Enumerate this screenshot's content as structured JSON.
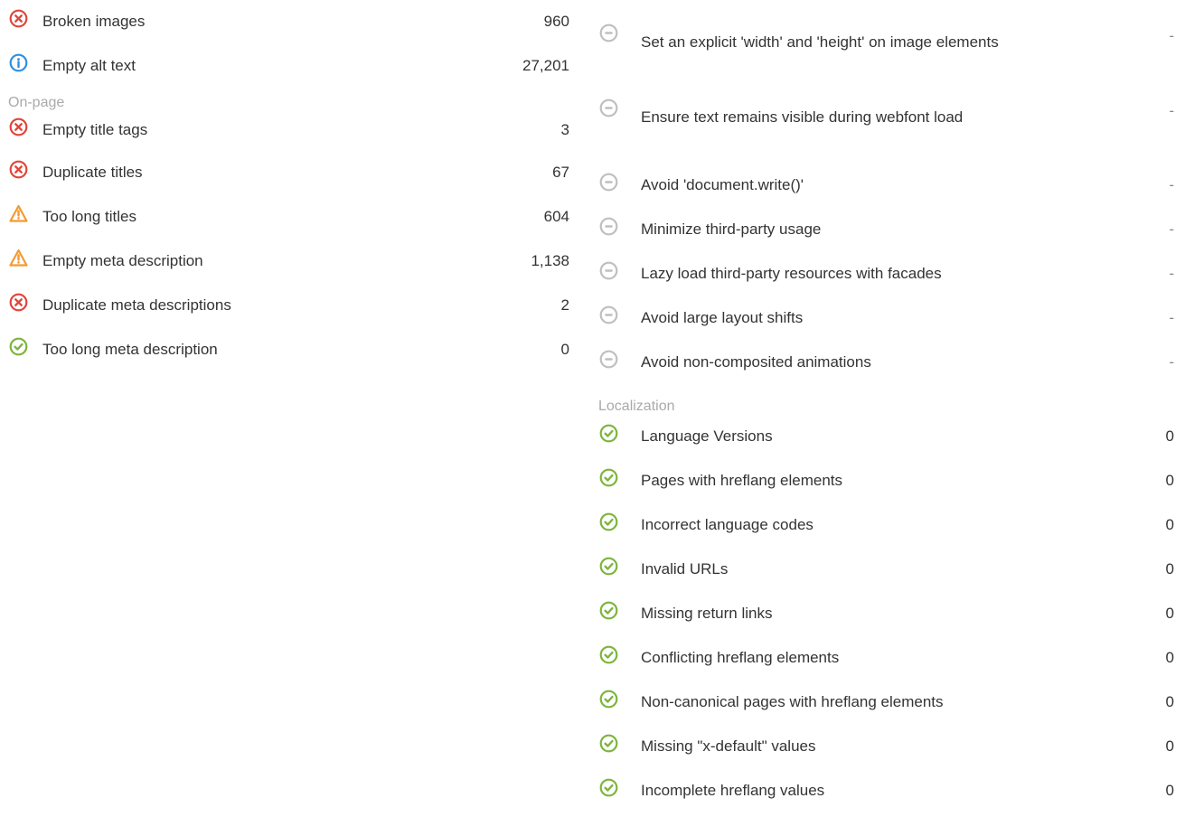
{
  "colors": {
    "error": "#e0453a",
    "info": "#2f8fe0",
    "warning": "#f39a32",
    "ok": "#7cb53b",
    "neutral": "#bfbfbf"
  },
  "left": {
    "top_rows": [
      {
        "icon": "error-circle-icon",
        "label": "Broken images",
        "value": "960"
      },
      {
        "icon": "info-circle-icon",
        "label": "Empty alt text",
        "value": "27,201"
      }
    ],
    "onpage": {
      "title": "On-page",
      "rows": [
        {
          "icon": "error-circle-icon",
          "label": "Empty title tags",
          "value": "3"
        },
        {
          "icon": "error-circle-icon",
          "label": "Duplicate titles",
          "value": "67"
        },
        {
          "icon": "warning-triangle-icon",
          "label": "Too long titles",
          "value": "604"
        },
        {
          "icon": "warning-triangle-icon",
          "label": "Empty meta description",
          "value": "1,138"
        },
        {
          "icon": "error-circle-icon",
          "label": "Duplicate meta descriptions",
          "value": "2"
        },
        {
          "icon": "check-circle-icon",
          "label": "Too long meta description",
          "value": "0"
        }
      ]
    }
  },
  "right": {
    "perf_rows": [
      {
        "icon": "minus-circle-icon",
        "label": "Set an explicit 'width' and 'height' on image elements",
        "value": "-"
      },
      {
        "icon": "minus-circle-icon",
        "label": "Ensure text remains visible during webfont load",
        "value": "-"
      },
      {
        "icon": "minus-circle-icon",
        "label": "Avoid 'document.write()'",
        "value": "-"
      },
      {
        "icon": "minus-circle-icon",
        "label": "Minimize third-party usage",
        "value": "-"
      },
      {
        "icon": "minus-circle-icon",
        "label": "Lazy load third-party resources with facades",
        "value": "-"
      },
      {
        "icon": "minus-circle-icon",
        "label": "Avoid large layout shifts",
        "value": "-"
      },
      {
        "icon": "minus-circle-icon",
        "label": "Avoid non-composited animations",
        "value": "-"
      }
    ],
    "localization": {
      "title": "Localization",
      "rows": [
        {
          "icon": "check-circle-icon",
          "label": "Language Versions",
          "value": "0"
        },
        {
          "icon": "check-circle-icon",
          "label": "Pages with hreflang elements",
          "value": "0"
        },
        {
          "icon": "check-circle-icon",
          "label": "Incorrect language codes",
          "value": "0"
        },
        {
          "icon": "check-circle-icon",
          "label": "Invalid URLs",
          "value": "0"
        },
        {
          "icon": "check-circle-icon",
          "label": "Missing return links",
          "value": "0"
        },
        {
          "icon": "check-circle-icon",
          "label": "Conflicting hreflang elements",
          "value": "0"
        },
        {
          "icon": "check-circle-icon",
          "label": "Non-canonical pages with hreflang elements",
          "value": "0"
        },
        {
          "icon": "check-circle-icon",
          "label": "Missing \"x-default\" values",
          "value": "0"
        },
        {
          "icon": "check-circle-icon",
          "label": "Incomplete hreflang values",
          "value": "0"
        }
      ]
    }
  }
}
